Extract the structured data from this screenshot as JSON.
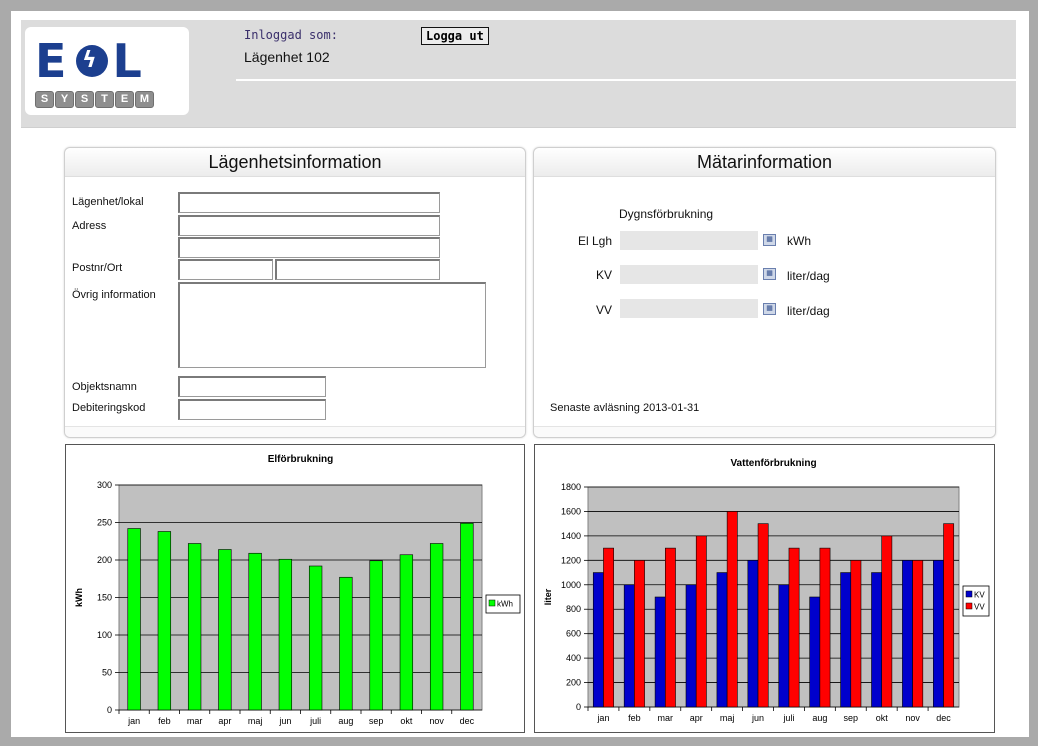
{
  "header": {
    "logo_text": "E L",
    "logo_sub": [
      "S",
      "Y",
      "S",
      "T",
      "E",
      "M"
    ],
    "logged_in_label": "Inloggad som:",
    "apartment": "Lägenhet 102",
    "logout_label": "Logga ut"
  },
  "apartment_panel": {
    "title": "Lägenhetsinformation",
    "fields": {
      "unit_label": "Lägenhet/lokal",
      "address_label": "Adress",
      "postal_label": "Postnr/Ort",
      "other_label": "Övrig information",
      "object_label": "Objektsnamn",
      "billing_label": "Debiteringskod"
    }
  },
  "meter_panel": {
    "title": "Mätarinformation",
    "heading": "Dygnsförbrukning",
    "rows": [
      {
        "label": "El Lgh",
        "unit": "kWh"
      },
      {
        "label": "KV",
        "unit": "liter/dag"
      },
      {
        "label": "VV",
        "unit": "liter/dag"
      }
    ],
    "last_reading": "Senaste avläsning 2013-01-31"
  },
  "colors": {
    "electric": "#00ff00",
    "cold_water": "#0000cc",
    "hot_water": "#ff0000",
    "plot_bg": "#c0c0c0",
    "brand": "#1c3f8f"
  },
  "chart_data": [
    {
      "type": "bar",
      "title": "Elförbrukning",
      "ylabel": "kWh",
      "xlabel": "",
      "categories": [
        "jan",
        "feb",
        "mar",
        "apr",
        "maj",
        "jun",
        "juli",
        "aug",
        "sep",
        "okt",
        "nov",
        "dec"
      ],
      "series": [
        {
          "name": "kWh",
          "values": [
            242,
            238,
            222,
            214,
            209,
            201,
            192,
            177,
            199,
            207,
            222,
            249
          ]
        }
      ],
      "ylim": [
        0,
        300
      ],
      "yticks": [
        "0",
        "50",
        "100",
        "150",
        "200",
        "250",
        "300"
      ],
      "grid": true,
      "legend": "right"
    },
    {
      "type": "bar",
      "title": "Vattenförbrukning",
      "ylabel": "liter",
      "xlabel": "",
      "categories": [
        "jan",
        "feb",
        "mar",
        "apr",
        "maj",
        "jun",
        "juli",
        "aug",
        "sep",
        "okt",
        "nov",
        "dec"
      ],
      "series": [
        {
          "name": "KV",
          "values": [
            1100,
            1000,
            900,
            1000,
            1100,
            1200,
            1000,
            900,
            1100,
            1100,
            1200,
            1200
          ]
        },
        {
          "name": "VV",
          "values": [
            1300,
            1200,
            1300,
            1400,
            1600,
            1500,
            1300,
            1300,
            1200,
            1400,
            1200,
            1500
          ]
        }
      ],
      "ylim": [
        0,
        1800
      ],
      "yticks": [
        "0",
        "200",
        "400",
        "600",
        "800",
        "1000",
        "1200",
        "1400",
        "1600",
        "1800"
      ],
      "grid": true,
      "legend": "right"
    }
  ]
}
